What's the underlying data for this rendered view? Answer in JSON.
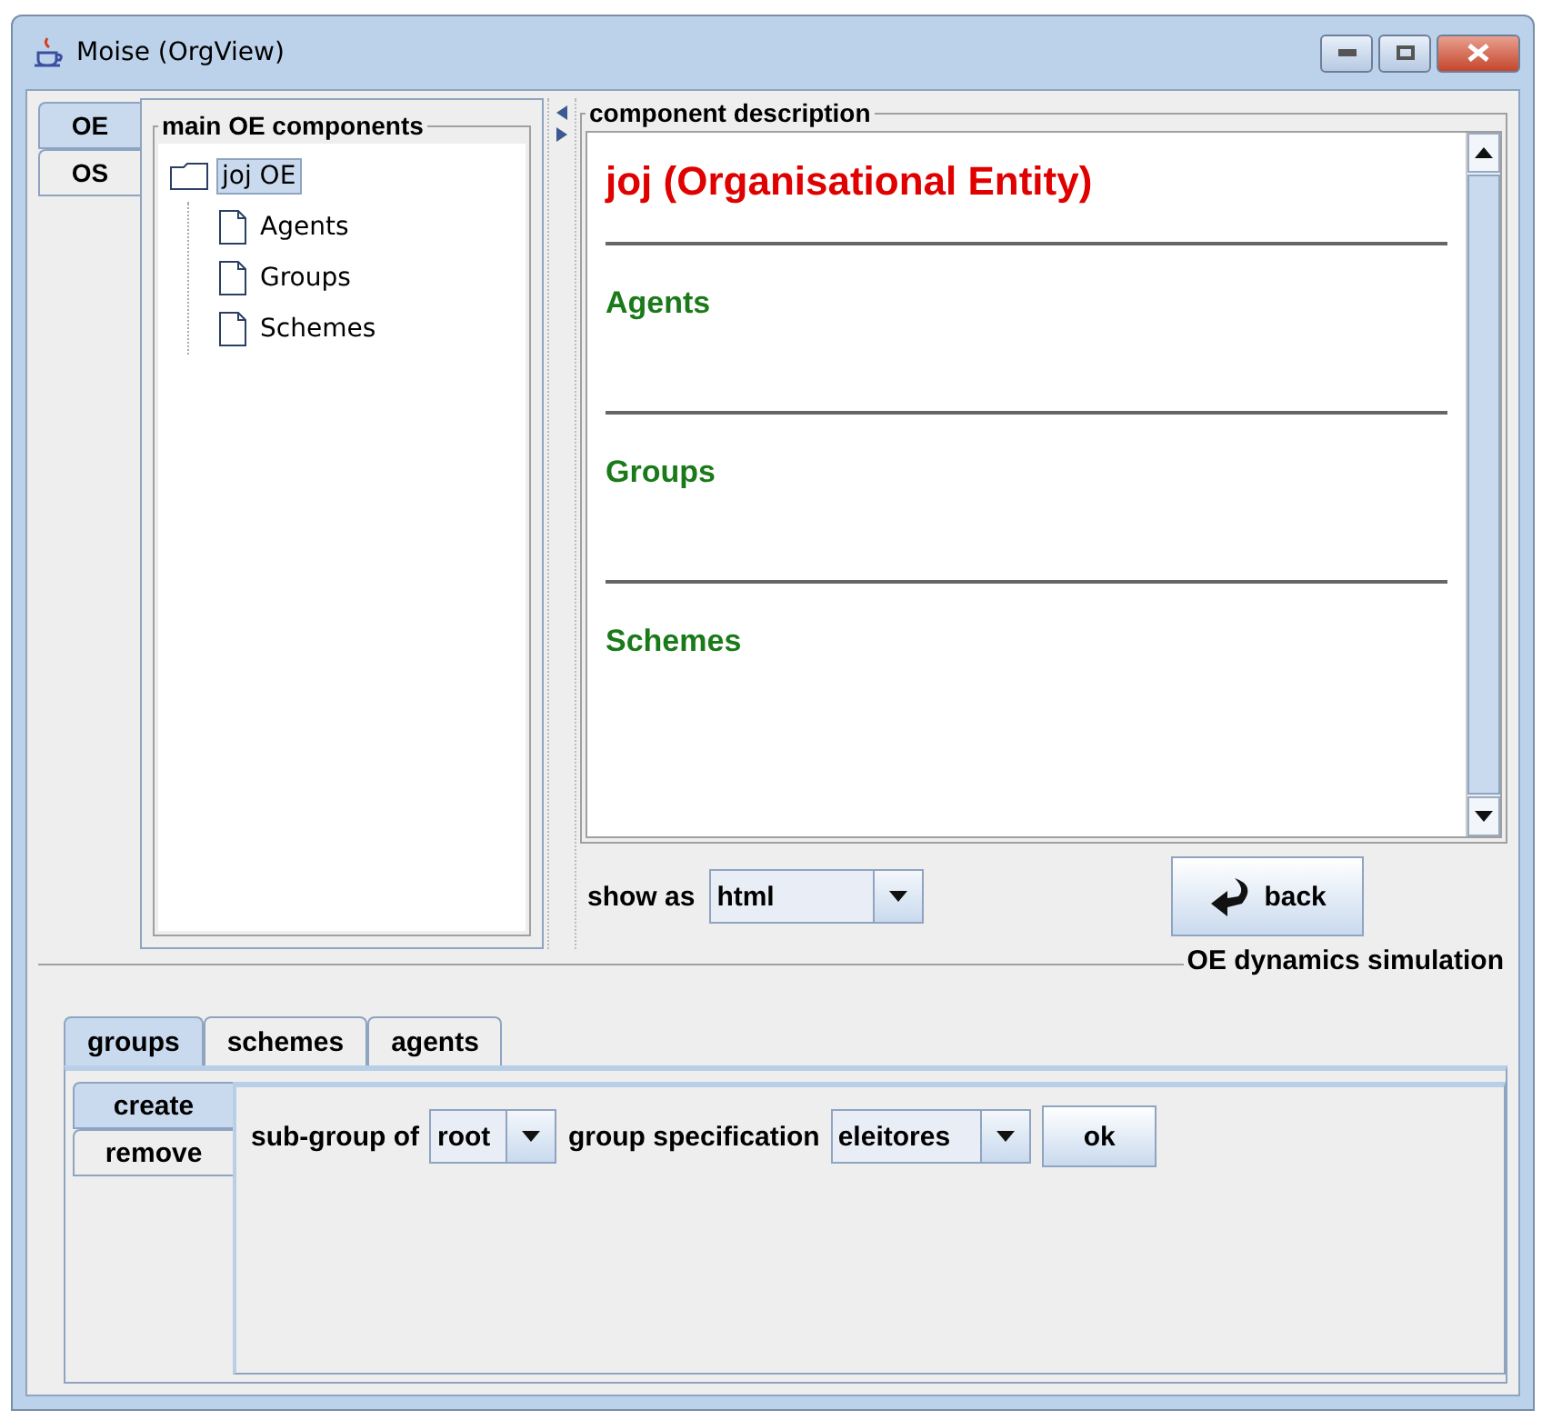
{
  "window": {
    "title": "Moise (OrgView)"
  },
  "side_tabs": [
    {
      "label": "OE",
      "selected": true
    },
    {
      "label": "OS",
      "selected": false
    }
  ],
  "tree": {
    "title": "main OE components",
    "root": {
      "label": "joj OE",
      "selected": true,
      "children": [
        {
          "label": "Agents",
          "selected": false
        },
        {
          "label": "Groups",
          "selected": false
        },
        {
          "label": "Schemes",
          "selected": false
        }
      ]
    }
  },
  "description": {
    "title": "component description",
    "heading": "joj (Organisational Entity)",
    "sections": [
      "Agents",
      "Groups",
      "Schemes"
    ],
    "show_as_label": "show as",
    "show_as_value": "html",
    "back_button": "back"
  },
  "simulation": {
    "title": "OE dynamics simulation",
    "tabs": [
      {
        "label": "groups",
        "selected": true
      },
      {
        "label": "schemes",
        "selected": false
      },
      {
        "label": "agents",
        "selected": false
      }
    ],
    "actions": [
      {
        "label": "create",
        "selected": true
      },
      {
        "label": "remove",
        "selected": false
      }
    ],
    "subgroup_label": "sub-group of",
    "subgroup_value": "root",
    "spec_label": "group specification",
    "spec_value": "eleitores",
    "ok_button": "ok"
  }
}
